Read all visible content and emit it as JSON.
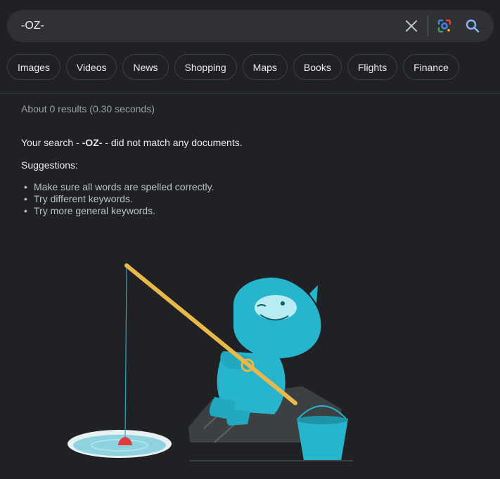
{
  "search": {
    "query": "-OZ-",
    "icons": [
      "close-icon",
      "google-lens-icon",
      "search-icon"
    ]
  },
  "tabs": [
    {
      "label": "Images"
    },
    {
      "label": "Videos"
    },
    {
      "label": "News"
    },
    {
      "label": "Shopping"
    },
    {
      "label": "Maps"
    },
    {
      "label": "Books"
    },
    {
      "label": "Flights"
    },
    {
      "label": "Finance"
    }
  ],
  "results": {
    "stats": "About 0 results (0.30 seconds)",
    "no_match_prefix": "Your search - ",
    "no_match_query": "-OZ-",
    "no_match_suffix": " - did not match any documents.",
    "suggestions_title": "Suggestions:",
    "suggestions": [
      "Make sure all words are spelled correctly.",
      "Try different keywords.",
      "Try more general keywords."
    ]
  },
  "colors": {
    "background": "#202124",
    "searchbar": "#303134",
    "yeti": "#26b5cc",
    "rod": "#e8b84a"
  },
  "illustration": {
    "name": "yeti-fishing-illustration"
  }
}
